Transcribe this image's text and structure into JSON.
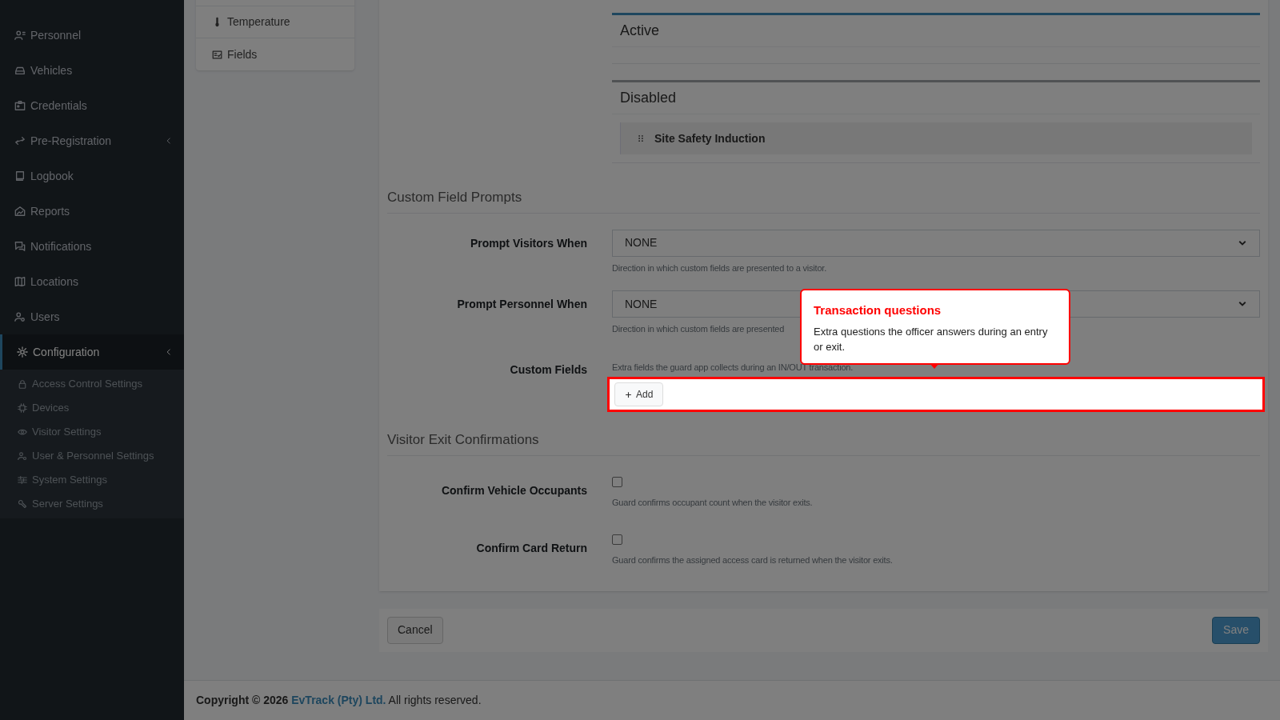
{
  "sidebar": {
    "items": [
      {
        "label": "Personnel",
        "kind": "link",
        "selected": false
      },
      {
        "label": "Vehicles",
        "kind": "link",
        "selected": false
      },
      {
        "label": "Credentials",
        "kind": "link",
        "selected": false
      },
      {
        "label": "Pre-Registration",
        "kind": "group",
        "selected": false
      },
      {
        "label": "Logbook",
        "kind": "link",
        "selected": false
      },
      {
        "label": "Reports",
        "kind": "link",
        "selected": false
      },
      {
        "label": "Notifications",
        "kind": "link",
        "selected": false
      },
      {
        "label": "Locations",
        "kind": "link",
        "selected": false
      },
      {
        "label": "Users",
        "kind": "link",
        "selected": false
      },
      {
        "label": "Configuration",
        "kind": "group",
        "selected": true,
        "children": [
          {
            "label": "Access Control Settings"
          },
          {
            "label": "Devices"
          },
          {
            "label": "Visitor Settings"
          },
          {
            "label": "User & Personnel Settings"
          },
          {
            "label": "System Settings"
          },
          {
            "label": "Server Settings"
          }
        ]
      }
    ]
  },
  "settings_nav": {
    "items": [
      {
        "label": "Temperature"
      },
      {
        "label": "Fields"
      }
    ]
  },
  "agreements": {
    "lists": [
      {
        "title": "Active",
        "kind": "active"
      },
      {
        "title": "Disabled",
        "kind": "disabled",
        "items": [
          "Site Safety Induction"
        ]
      }
    ]
  },
  "sections": [
    {
      "title": "Custom Field Prompts",
      "rows": [
        {
          "kind": "select",
          "label": "Prompt Visitors When",
          "value": "NONE",
          "help": "Direction in which custom fields are presented to a visitor."
        },
        {
          "kind": "select",
          "label": "Prompt Personnel When",
          "value": "NONE",
          "help": "Direction in which custom fields are presented"
        },
        {
          "kind": "add",
          "label": "Custom Fields",
          "help": "Extra fields the guard app collects during an IN/OUT transaction.",
          "button": "Add",
          "highlighted": true
        }
      ]
    },
    {
      "title": "Visitor Exit Confirmations",
      "rows": [
        {
          "kind": "checkbox",
          "label": "Confirm Vehicle Occupants",
          "checked": false,
          "help": "Guard confirms occupant count when the visitor exits."
        },
        {
          "kind": "checkbox",
          "label": "Confirm Card Return",
          "checked": false,
          "help": "Guard confirms the assigned access card is returned when the visitor exits."
        }
      ]
    }
  ],
  "actions": {
    "cancel": "Cancel",
    "save": "Save"
  },
  "footer": {
    "copyright": "Copyright © 2026",
    "company": "EvTrack (Pty) Ltd.",
    "rights": "All rights reserved."
  },
  "tour": {
    "title": "Transaction questions",
    "body": "Extra questions the officer answers during an entry or exit."
  }
}
